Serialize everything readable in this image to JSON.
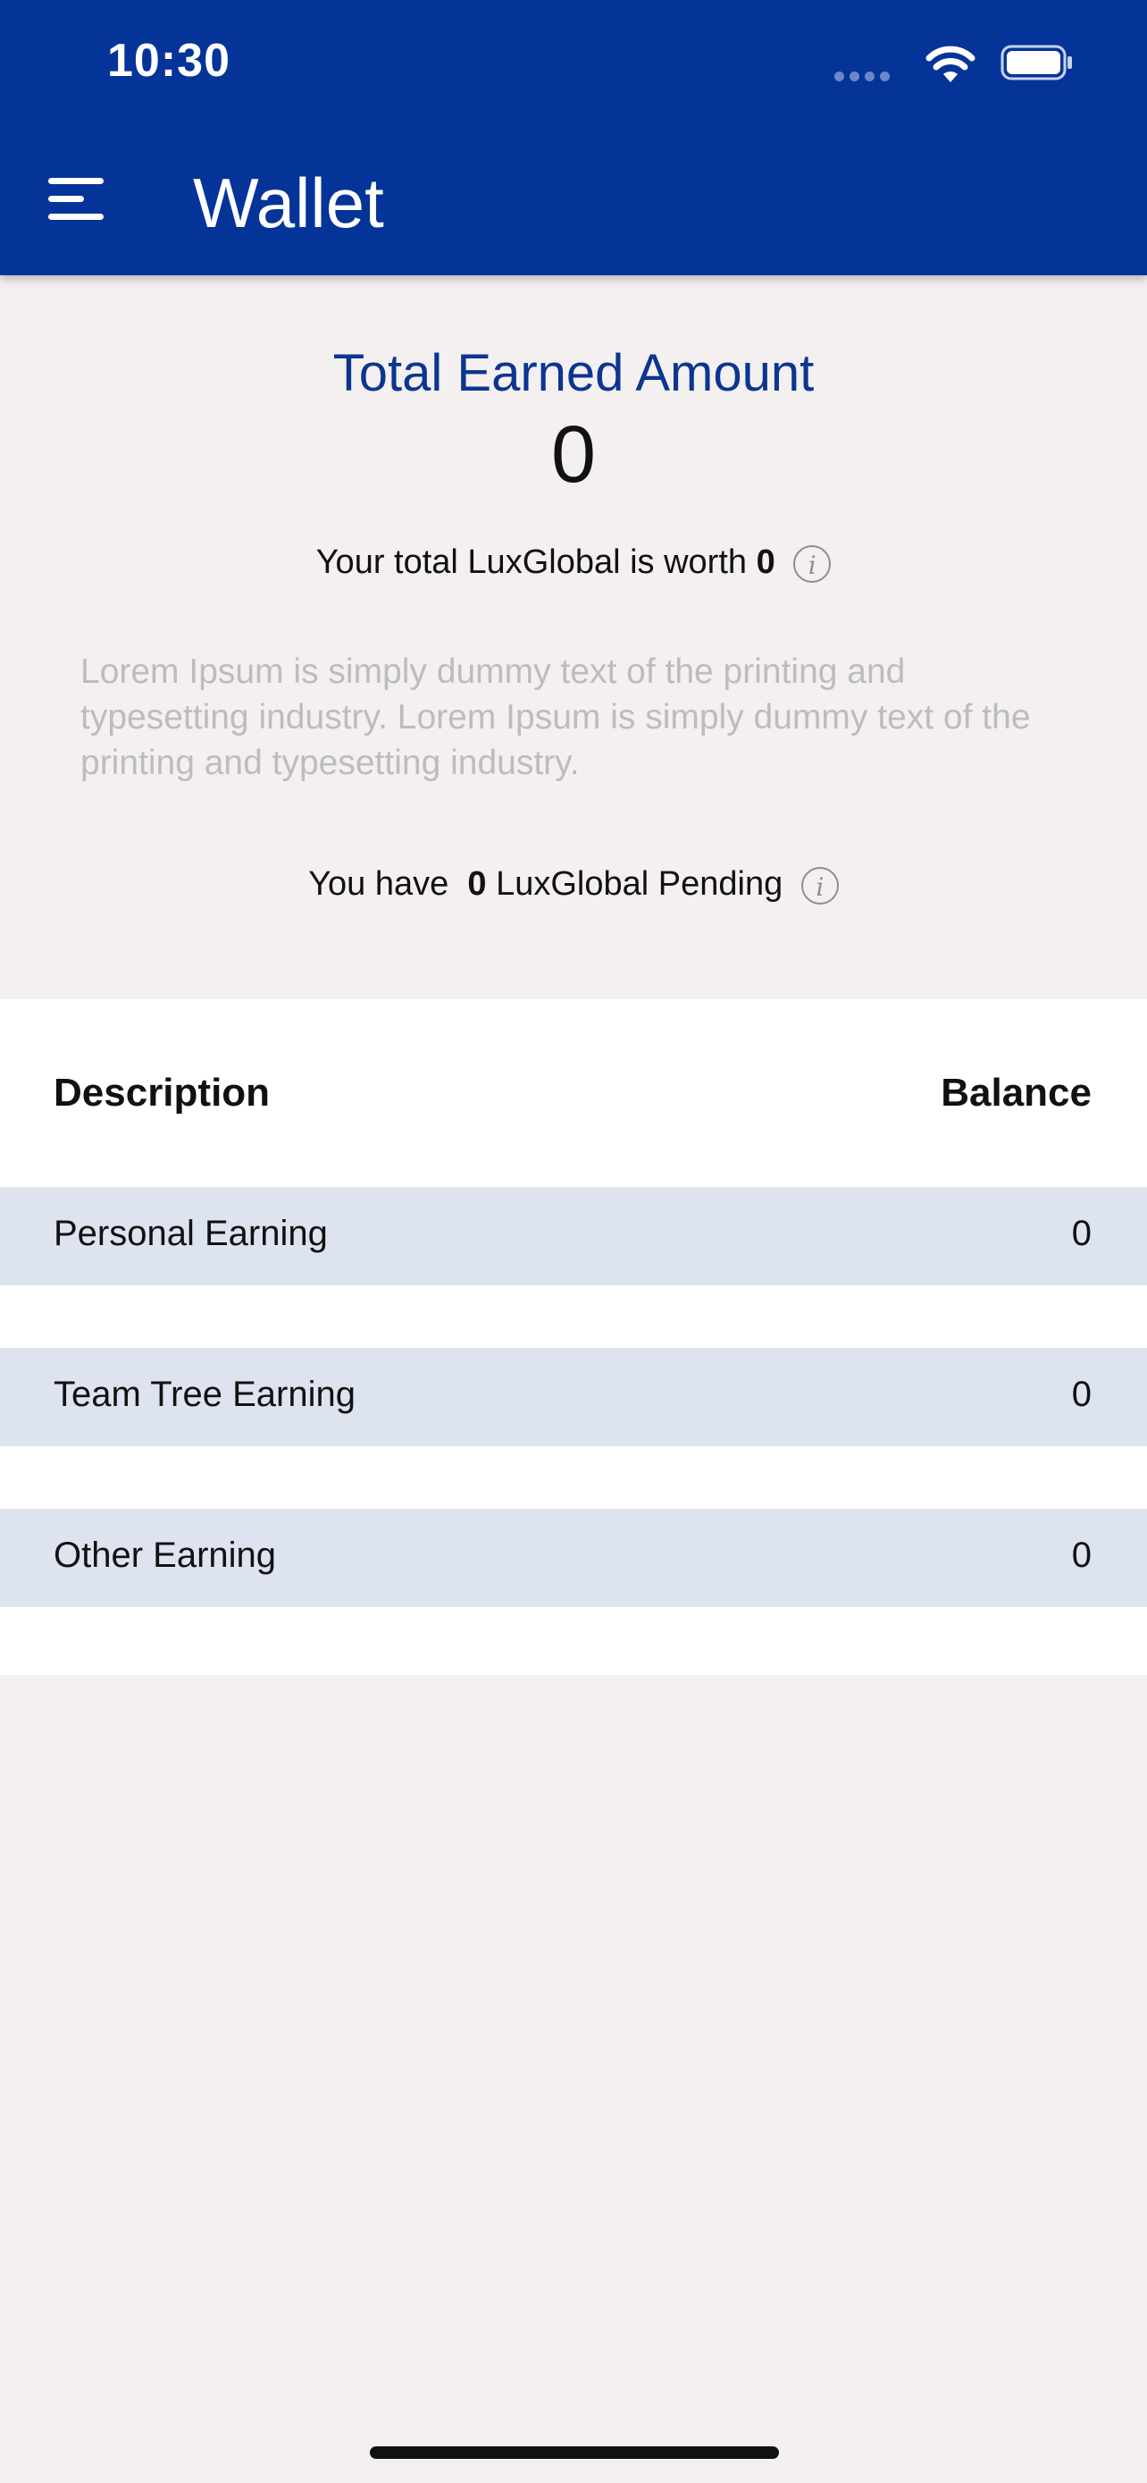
{
  "status_bar": {
    "time": "10:30"
  },
  "header": {
    "title": "Wallet",
    "menu_icon": "hamburger-menu-icon"
  },
  "summary": {
    "total_label": "Total Earned Amount",
    "total_value": "0",
    "worth_prefix": "Your total LuxGlobal is worth",
    "worth_value": "0",
    "description": "Lorem Ipsum is simply dummy text of the printing and typesetting industry. Lorem Ipsum is simply dummy text of the printing and typesetting industry.",
    "pending_prefix": "You have",
    "pending_value": "0",
    "pending_suffix": "LuxGlobal Pending",
    "info_glyph": "i"
  },
  "table": {
    "headers": {
      "description": "Description",
      "balance": "Balance"
    },
    "rows": [
      {
        "description": "Personal Earning",
        "balance": "0"
      },
      {
        "description": "Team Tree Earning",
        "balance": "0"
      },
      {
        "description": "Other Earning",
        "balance": "0"
      }
    ]
  },
  "colors": {
    "header_bg": "#053499",
    "accent_text": "#0b3591",
    "page_bg": "#f3f0ef",
    "row_bg": "#dee3f0"
  }
}
